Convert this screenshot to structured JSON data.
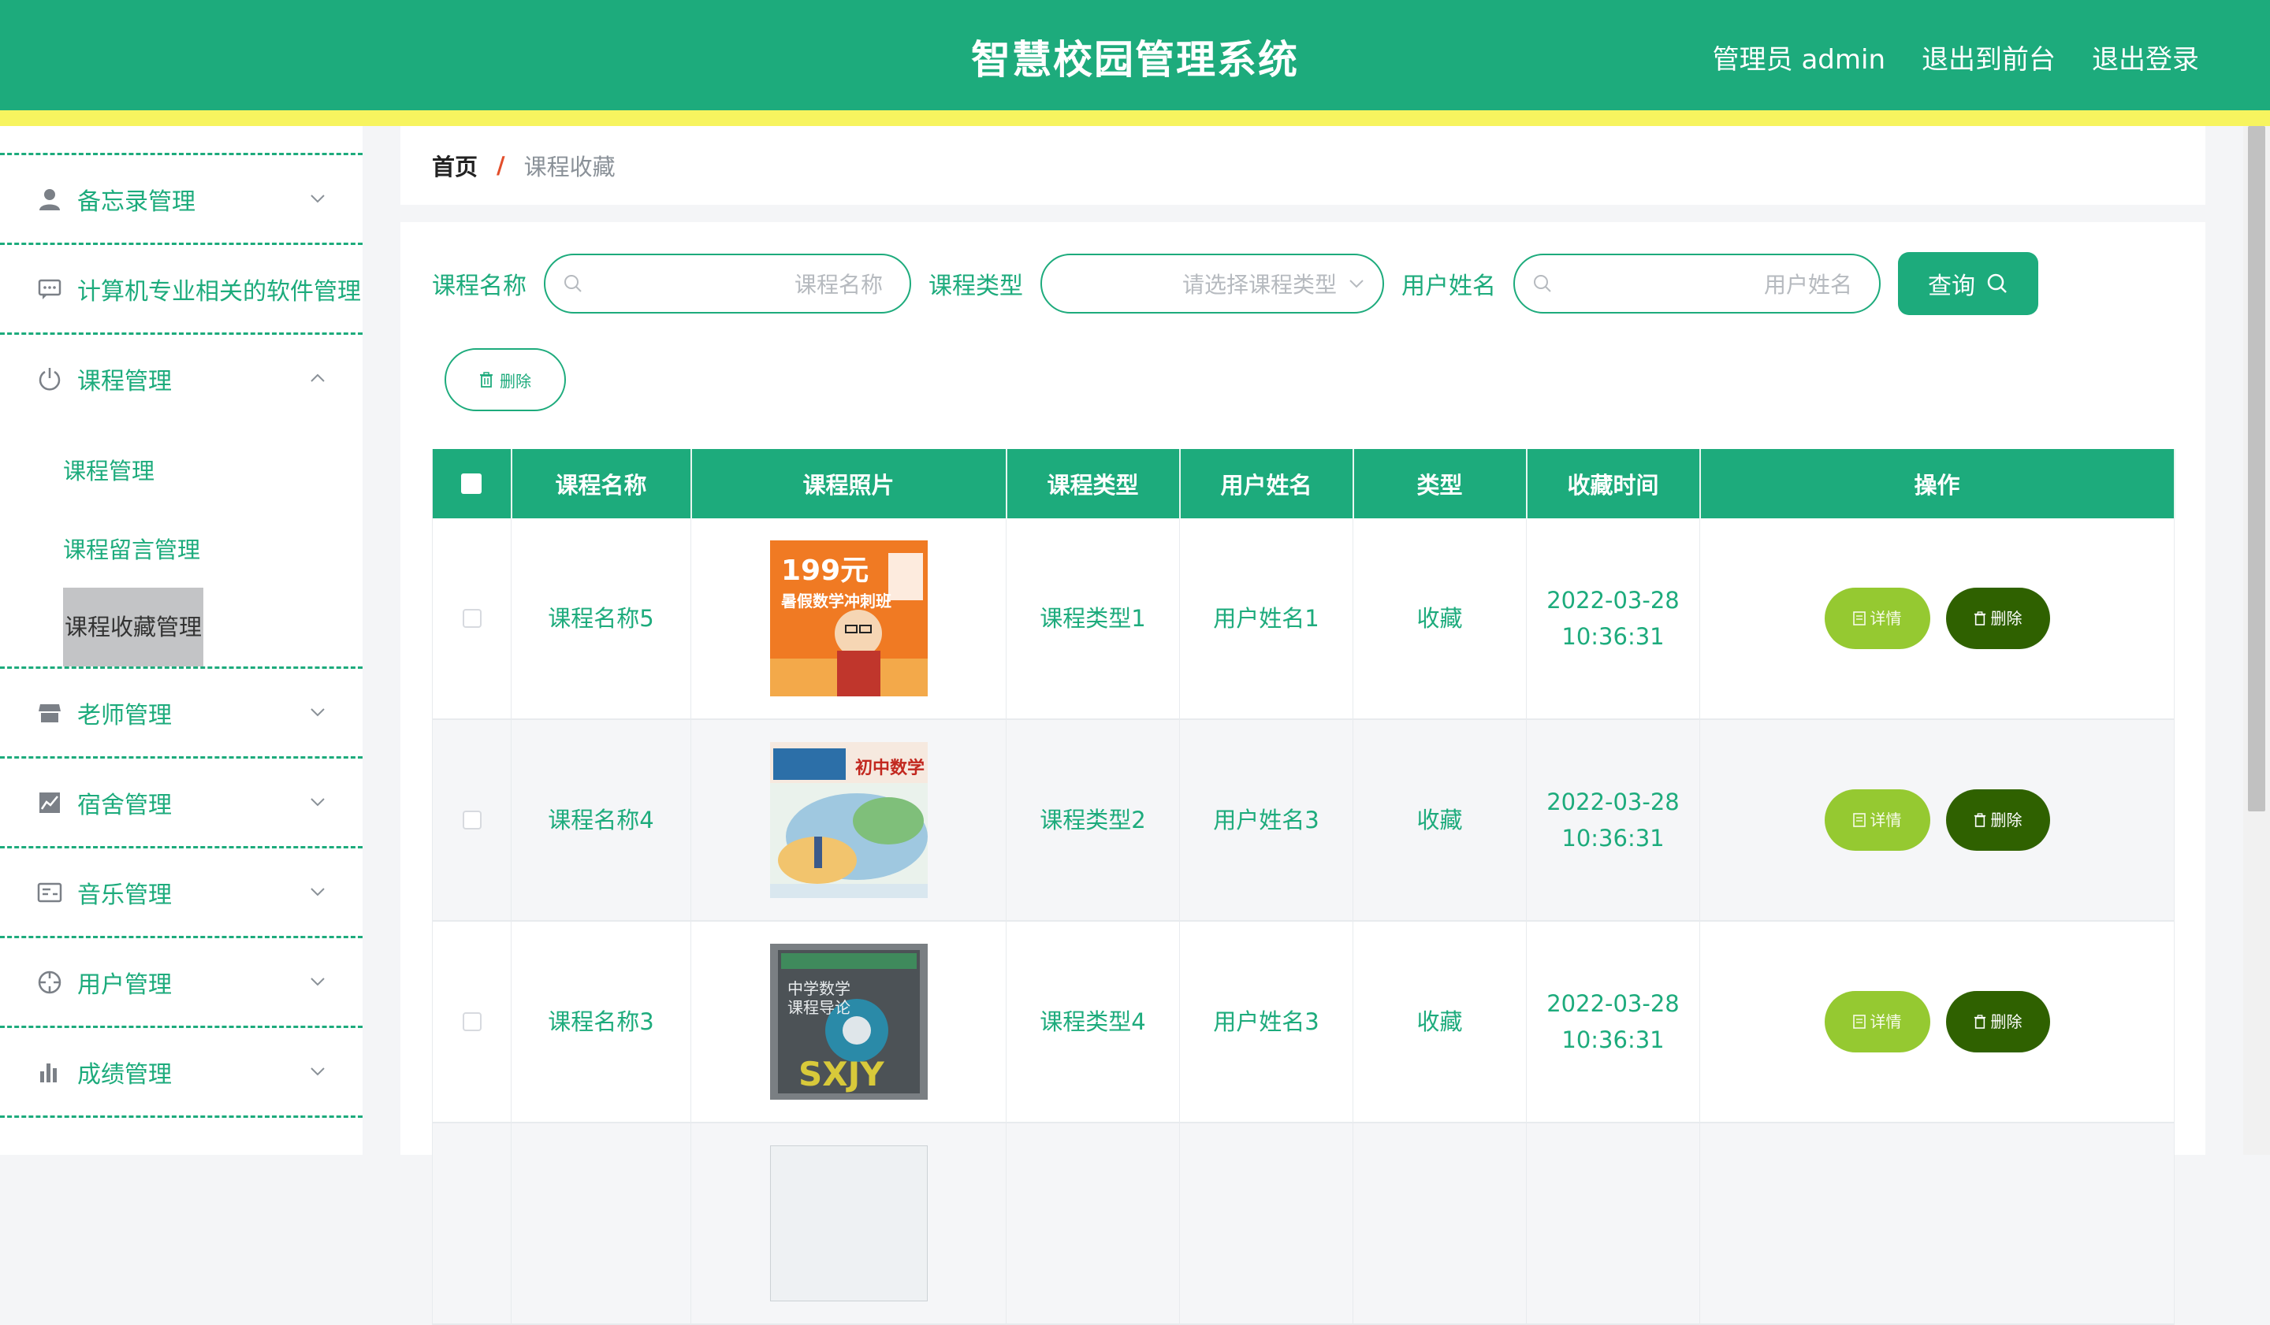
{
  "header": {
    "title": "智慧校园管理系统",
    "user": "管理员 admin",
    "to_front": "退出到前台",
    "logout": "退出登录",
    "colors": {
      "primary": "#1dab7c",
      "stripe": "#f7f45f"
    }
  },
  "sidebar": {
    "items": [
      {
        "label": "备忘录管理",
        "icon": "user-icon"
      },
      {
        "label": "计算机专业相关的软件管理",
        "icon": "chat-icon"
      },
      {
        "label": "课程管理",
        "icon": "power-icon",
        "expanded": true,
        "children": [
          {
            "label": "课程管理"
          },
          {
            "label": "课程留言管理"
          },
          {
            "label": "课程收藏管理",
            "active": true
          }
        ]
      },
      {
        "label": "老师管理",
        "icon": "store-icon"
      },
      {
        "label": "宿舍管理",
        "icon": "chart-icon"
      },
      {
        "label": "音乐管理",
        "icon": "card-icon"
      },
      {
        "label": "用户管理",
        "icon": "target-icon"
      },
      {
        "label": "成绩管理",
        "icon": "bar-icon"
      }
    ]
  },
  "breadcrumb": {
    "home": "首页",
    "separator": "/",
    "current": "课程收藏"
  },
  "filters": {
    "course_name_label": "课程名称",
    "course_name_placeholder": "课程名称",
    "course_type_label": "课程类型",
    "course_type_placeholder": "请选择课程类型",
    "user_name_label": "用户姓名",
    "user_name_placeholder": "用户姓名",
    "query_label": "查询"
  },
  "toolbar": {
    "delete_label": "删除"
  },
  "table": {
    "columns": [
      "课程名称",
      "课程照片",
      "课程类型",
      "用户姓名",
      "类型",
      "收藏时间",
      "操作"
    ],
    "rows": [
      {
        "name": "课程名称5",
        "type": "课程类型1",
        "user": "用户姓名1",
        "kind": "收藏",
        "date": "2022-03-28",
        "time": "10:36:31"
      },
      {
        "name": "课程名称4",
        "type": "课程类型2",
        "user": "用户姓名3",
        "kind": "收藏",
        "date": "2022-03-28",
        "time": "10:36:31"
      },
      {
        "name": "课程名称3",
        "type": "课程类型4",
        "user": "用户姓名3",
        "kind": "收藏",
        "date": "2022-03-28",
        "time": "10:36:31"
      }
    ],
    "detail_label": "详情",
    "delete_label": "删除",
    "thumb_text": {
      "row1_big": "199元",
      "row1_sub": "暑假数学冲刺班",
      "row2_title": "初中数学",
      "row3_line1": "中学数学",
      "row3_line2": "课程导论",
      "row3_logo": "SXJY"
    }
  }
}
